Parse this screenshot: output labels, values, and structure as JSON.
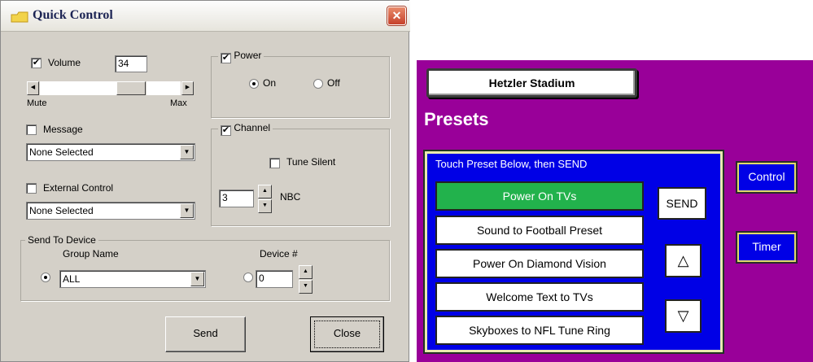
{
  "dialog": {
    "title": "Quick Control",
    "close_glyph": "✕",
    "volume": {
      "label": "Volume",
      "checked": true,
      "value": "34",
      "min_label": "Mute",
      "max_label": "Max",
      "left_arrow": "◀",
      "right_arrow": "▶"
    },
    "power": {
      "label": "Power",
      "checked": true,
      "on_label": "On",
      "off_label": "Off",
      "selected": "On"
    },
    "message": {
      "label": "Message",
      "checked": false,
      "selection": "None Selected"
    },
    "channel": {
      "label": "Channel",
      "checked": true,
      "tune_silent_label": "Tune Silent",
      "number": "3",
      "name": "NBC"
    },
    "external_control": {
      "label": "External Control",
      "checked": false,
      "selection": "None Selected"
    },
    "send_to_device": {
      "label": "Send To Device",
      "group_name_label": "Group Name",
      "group_value": "ALL",
      "device_label": "Device #",
      "device_value": "0"
    },
    "buttons": {
      "send": "Send",
      "close": "Close"
    },
    "arrow_down": "▼",
    "arrow_up": "▲",
    "check_mark": "✔"
  },
  "panel": {
    "background": "#990099",
    "venue": "Hetzler Stadium",
    "title": "Presets",
    "instruction": "Touch Preset Below, then SEND",
    "presets": [
      {
        "label": "Power On TVs",
        "active": true
      },
      {
        "label": "Sound to Football Preset",
        "active": false
      },
      {
        "label": "Power On Diamond Vision",
        "active": false
      },
      {
        "label": "Welcome Text to TVs",
        "active": false
      },
      {
        "label": "Skyboxes to NFL Tune Ring",
        "active": false
      }
    ],
    "send_label": "SEND",
    "up_glyph": "△",
    "down_glyph": "▽",
    "control_label": "Control",
    "timer_label": "Timer",
    "colors": {
      "blue": "#0000e6",
      "active_green": "#22b24c",
      "border_yellow": "#e3d96a"
    }
  }
}
